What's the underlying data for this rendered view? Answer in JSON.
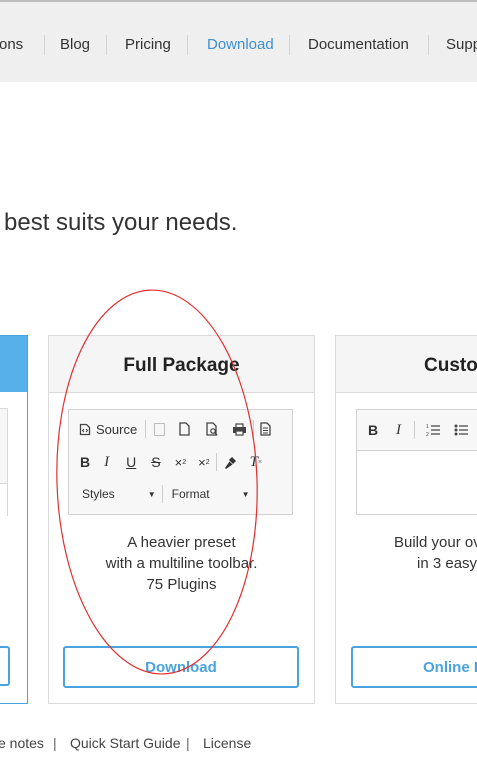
{
  "nav": {
    "items": [
      {
        "label": "ons",
        "active": false
      },
      {
        "label": "Blog",
        "active": false
      },
      {
        "label": "Pricing",
        "active": false
      },
      {
        "label": "Download",
        "active": true
      },
      {
        "label": "Documentation",
        "active": false
      },
      {
        "label": "Supp",
        "active": false
      }
    ]
  },
  "subtitle": "best suits your needs.",
  "packages": {
    "full": {
      "title": "Full Package",
      "toolbar": {
        "source_label": "Source",
        "styles_label": "Styles",
        "format_label": "Format"
      },
      "desc_lines": [
        "A heavier preset",
        "with a multiline toolbar.",
        "75 Plugins"
      ],
      "button": "Download"
    },
    "custom": {
      "title": "Custo",
      "desc_lines": [
        "Build your ov",
        "in 3 easy"
      ],
      "button": "Online B"
    }
  },
  "footer": {
    "links": [
      "e notes",
      "Quick Start Guide",
      "License"
    ],
    "separator": "|"
  },
  "colors": {
    "accent": "#3d8fd6",
    "button_border": "#4aa3df",
    "annotation": "#e03030"
  }
}
